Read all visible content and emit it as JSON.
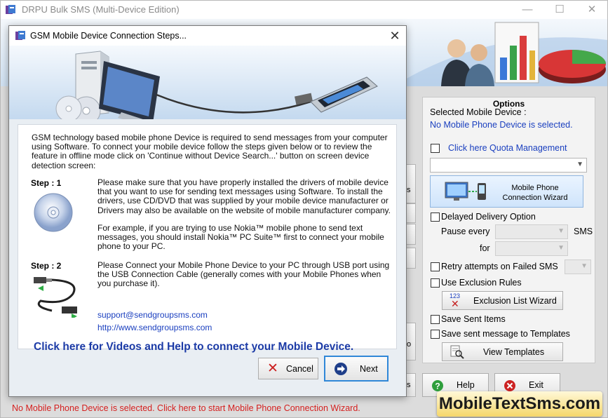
{
  "app": {
    "title": "DRPU Bulk SMS (Multi-Device Edition)"
  },
  "dialog": {
    "title": "GSM Mobile Device Connection Steps...",
    "intro": "GSM technology based mobile phone Device is required to send messages from your computer using Software.  To connect your mobile device follow the steps given below or to review the feature in offline mode click on 'Continue without Device Search...' button on screen device detection screen:",
    "step1_label": "Step : 1",
    "step1_text": "Please make sure that you have properly installed the drivers of mobile device that you want to use for sending text messages using Software. To install the drivers, use CD/DVD that was supplied by your mobile device manufacturer or Drivers may also be available on the website of mobile manufacturer company.",
    "step1_example": "For example, if you are trying to use Nokia™ mobile phone to send text messages, you should install Nokia™ PC Suite™ first to connect your mobile phone to your PC.",
    "step2_label": "Step : 2",
    "step2_text": "Please Connect your Mobile Phone Device to your PC through USB port using the USB Connection Cable (generally comes with your Mobile Phones when you purchase it).",
    "email": "support@sendgroupsms.com",
    "website": "http://www.sendgroupsms.com",
    "help_link": "Click here for Videos and Help to connect your Mobile Device.",
    "cancel_label": "Cancel",
    "next_label": "Next"
  },
  "options": {
    "title": "Options",
    "selected_device_label": "Selected Mobile Device :",
    "selected_device_value": "No Mobile Phone Device is selected.",
    "quota_label": "Click here Quota Management",
    "wizard_label": "Mobile Phone Connection  Wizard",
    "delayed_label": "Delayed Delivery Option",
    "pause_every_label": "Pause every",
    "sms_label": "SMS",
    "for_label": "for",
    "retry_label": "Retry attempts on Failed SMS",
    "exclusion_label": "Use Exclusion Rules",
    "exclusion_wizard_label": "Exclusion List Wizard",
    "exclusion_icon_text": "123",
    "save_sent_label": "Save Sent Items",
    "save_templates_label": "Save sent message to Templates",
    "view_templates_label": "View Templates"
  },
  "footer": {
    "help_label": "Help",
    "exit_label": "Exit",
    "status_text": "No Mobile Phone Device is selected. Click here to start Mobile Phone Connection Wizard.",
    "watermark": "MobileTextSms.com"
  },
  "stubs": [
    "s",
    "o",
    "s"
  ],
  "colors": {
    "link_blue": "#1a3fbf",
    "status_red": "#d4201f",
    "next_border": "#2f87d8",
    "cancel_red": "#cc1f1f"
  }
}
